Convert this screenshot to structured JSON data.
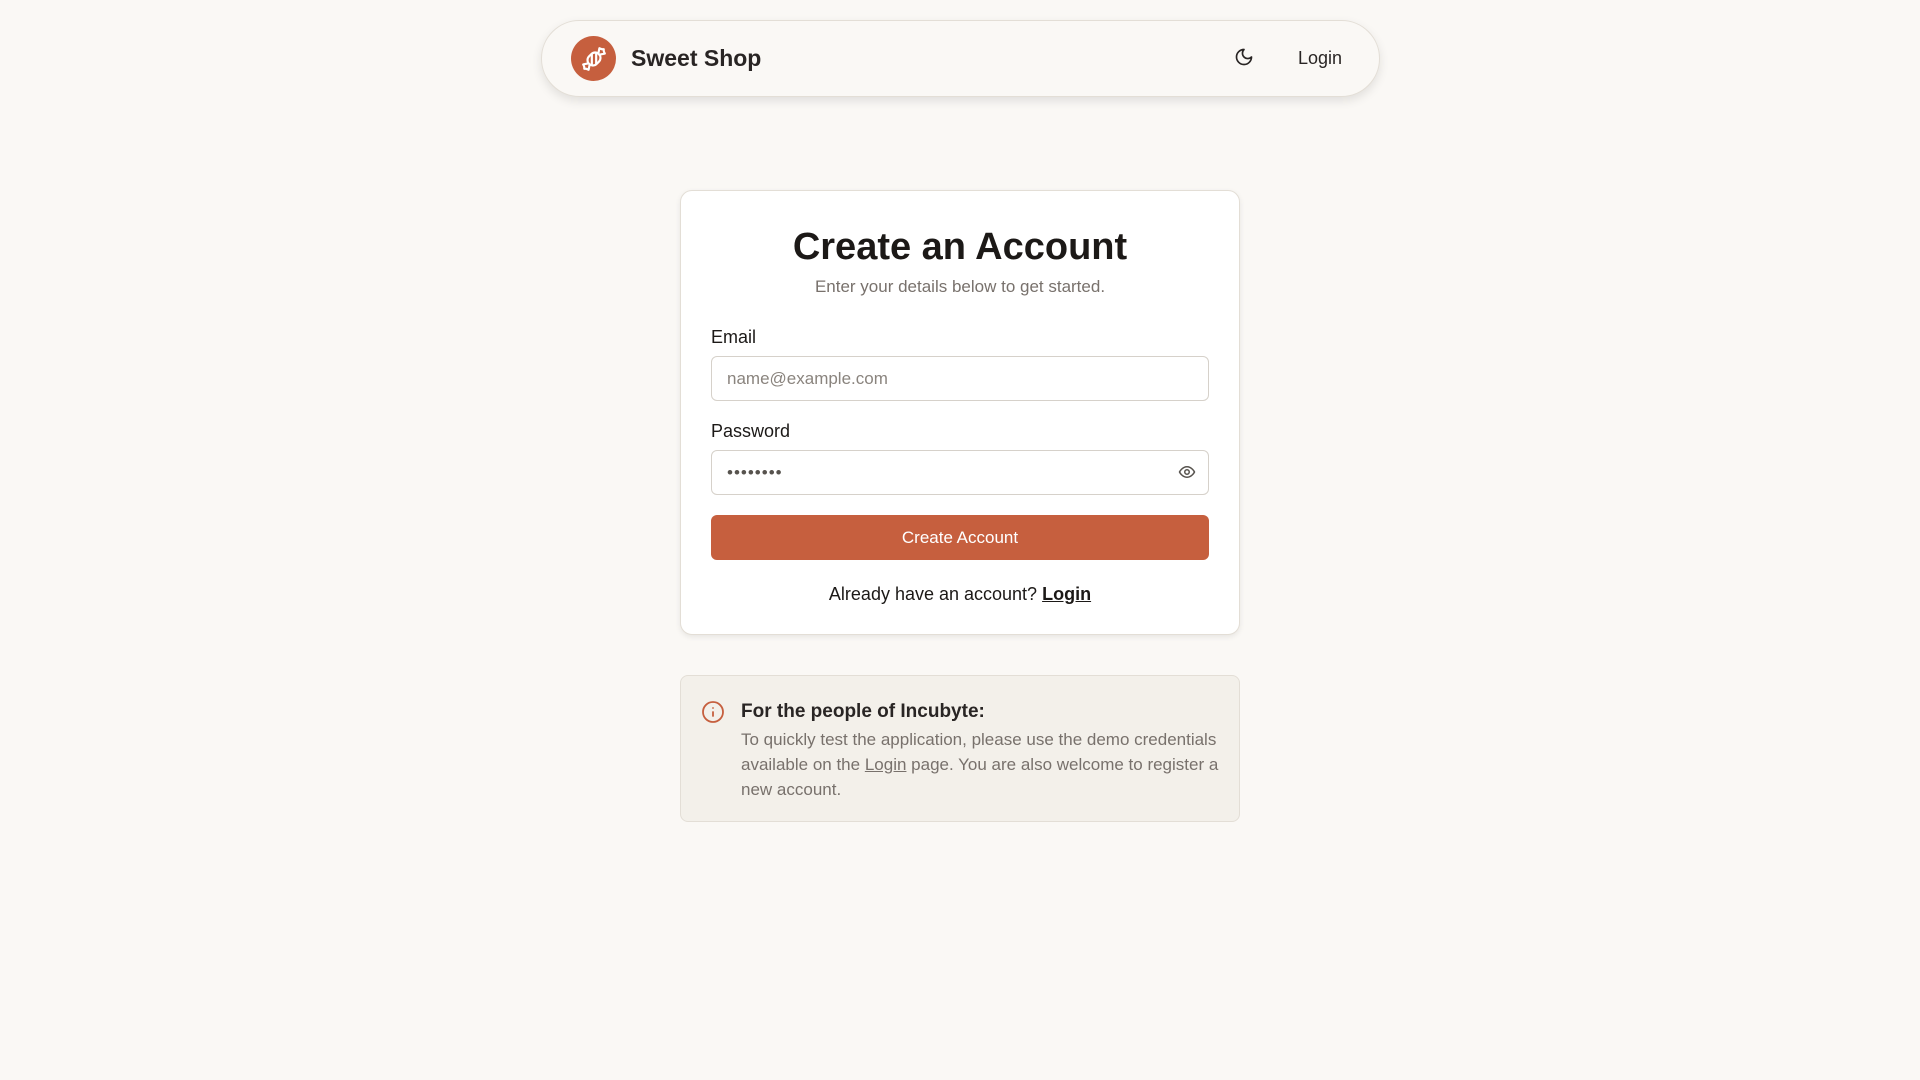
{
  "header": {
    "brand": "Sweet Shop",
    "login_label": "Login"
  },
  "form": {
    "title": "Create an Account",
    "subtitle": "Enter your details below to get started.",
    "email_label": "Email",
    "email_placeholder": "name@example.com",
    "email_value": "",
    "password_label": "Password",
    "password_value": "••••••••",
    "submit_label": "Create Account",
    "switch_text": "Already have an account?",
    "switch_link": "Login"
  },
  "notice": {
    "title": "For the people of Incubyte:",
    "text_before": "To quickly test the application, please use the demo credentials available on the",
    "link": "Login",
    "text_after": "page. You are also welcome to register a new account."
  },
  "colors": {
    "accent": "#c65f3e",
    "background": "#faf8f5",
    "notice_bg": "#f3f0ea"
  },
  "icons": {
    "logo": "candy-icon",
    "theme": "moon-icon",
    "password_toggle": "eye-icon",
    "notice": "info-icon"
  }
}
